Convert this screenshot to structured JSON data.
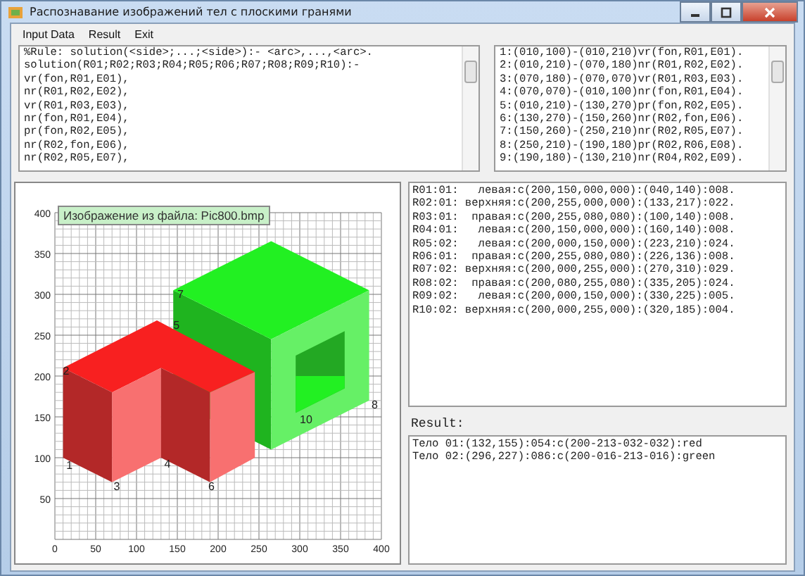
{
  "window": {
    "title": "Распознавание изображений тел с плоскими гранями"
  },
  "menu": [
    {
      "label": "Input Data"
    },
    {
      "label": "Result"
    },
    {
      "label": "Exit"
    }
  ],
  "rules_text": [
    "%Rule: solution(<side>;...;<side>):- <arc>,...,<arc>.",
    "solution(R01;R02;R03;R04;R05;R06;R07;R08;R09;R10):-",
    "vr(fon,R01,E01),",
    "nr(R01,R02,E02),",
    "vr(R01,R03,E03),",
    "nr(fon,R01,E04),",
    "pr(fon,R02,E05),",
    "nr(R02,fon,E06),",
    "nr(R02,R05,E07),"
  ],
  "edges_text": [
    "1:(010,100)-(010,210)vr(fon,R01,E01).",
    "2:(010,210)-(070,180)nr(R01,R02,E02).",
    "3:(070,180)-(070,070)vr(R01,R03,E03).",
    "4:(070,070)-(010,100)nr(fon,R01,E04).",
    "5:(010,210)-(130,270)pr(fon,R02,E05).",
    "6:(130,270)-(150,260)nr(R02,fon,E06).",
    "7:(150,260)-(250,210)nr(R02,R05,E07).",
    "8:(250,210)-(190,180)pr(R02,R06,E08).",
    "9:(190,180)-(130,210)nr(R04,R02,E09)."
  ],
  "image_panel": {
    "caption": "Изображение из файла: Pic800.bmp",
    "x_ticks": [
      "0",
      "50",
      "100",
      "150",
      "200",
      "250",
      "300",
      "350",
      "400"
    ],
    "y_ticks": [
      "400",
      "350",
      "300",
      "250",
      "200",
      "150",
      "100",
      "50"
    ],
    "point_labels": [
      "1",
      "2",
      "3",
      "4",
      "5",
      "6",
      "7",
      "8",
      "10"
    ]
  },
  "regions_text": [
    "R01:01:   левая:c(200,150,000,000):(040,140):008.",
    "R02:01: верхняя:c(200,255,000,000):(133,217):022.",
    "R03:01:  правая:c(200,255,080,080):(100,140):008.",
    "R04:01:   левая:c(200,150,000,000):(160,140):008.",
    "R05:02:   левая:c(200,000,150,000):(223,210):024.",
    "R06:01:  правая:c(200,255,080,080):(226,136):008.",
    "R07:02: верхняя:c(200,000,255,000):(270,310):029.",
    "R08:02:  правая:c(200,080,255,080):(335,205):024.",
    "R09:02:   левая:c(200,000,150,000):(330,225):005.",
    "R10:02: верхняя:c(200,000,255,000):(320,185):004."
  ],
  "result_label": "Result:",
  "result_text": [
    "Тело 01:(132,155):054:c(200-213-032-032):red",
    "Тело 02:(296,227):086:c(200-016-213-016):green"
  ]
}
